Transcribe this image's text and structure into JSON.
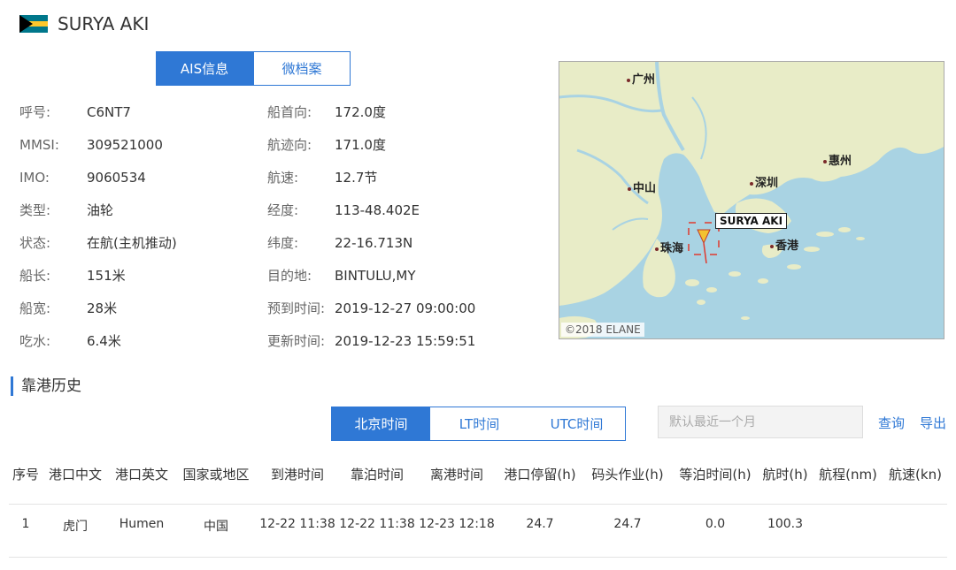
{
  "ship": {
    "name": "SURYA AKI",
    "flag_colors": [
      "#00778b",
      "#ffc72c",
      "#000000"
    ]
  },
  "info_tabs": [
    "AIS信息",
    "微档案"
  ],
  "info_left": [
    {
      "label": "呼号:",
      "value": "C6NT7"
    },
    {
      "label": "MMSI:",
      "value": "309521000"
    },
    {
      "label": "IMO:",
      "value": "9060534"
    },
    {
      "label": "类型:",
      "value": "油轮"
    },
    {
      "label": "状态:",
      "value": "在航(主机推动)"
    },
    {
      "label": "船长:",
      "value": "151米"
    },
    {
      "label": "船宽:",
      "value": "28米"
    },
    {
      "label": "吃水:",
      "value": "6.4米"
    }
  ],
  "info_right": [
    {
      "label": "船首向:",
      "value": "172.0度"
    },
    {
      "label": "航迹向:",
      "value": "171.0度"
    },
    {
      "label": "航速:",
      "value": "12.7节"
    },
    {
      "label": "经度:",
      "value": "113-48.402E"
    },
    {
      "label": "纬度:",
      "value": "22-16.713N"
    },
    {
      "label": "目的地:",
      "value": "BINTULU,MY"
    },
    {
      "label": "预到时间:",
      "value": "2019-12-27 09:00:00"
    },
    {
      "label": "更新时间:",
      "value": "2019-12-23 15:59:51"
    }
  ],
  "map": {
    "cities": [
      "广州",
      "惠州",
      "中山",
      "深圳",
      "珠海",
      "香港"
    ],
    "ship_label": "SURYA AKI",
    "copyright": "©2018 ELANE",
    "colors": {
      "water": "#a9d3e3",
      "land": "#e8ecc7",
      "marker": "#f2c230",
      "box": "#e03a2e"
    }
  },
  "port_history": {
    "title": "靠港历史",
    "time_tabs": [
      "北京时间",
      "LT时间",
      "UTC时间"
    ],
    "range_placeholder": "默认最近一个月",
    "query_label": "查询",
    "export_label": "导出",
    "columns": [
      "序号",
      "港口中文",
      "港口英文",
      "国家或地区",
      "到港时间",
      "靠泊时间",
      "离港时间",
      "港口停留(h)",
      "码头作业(h)",
      "等泊时间(h)",
      "航时(h)",
      "航程(nm)",
      "航速(kn)"
    ],
    "rows": [
      [
        "1",
        "虎门",
        "Humen",
        "中国",
        "12-22 11:38",
        "12-22 11:38",
        "12-23 12:18",
        "24.7",
        "24.7",
        "0.0",
        "100.3",
        "",
        ""
      ]
    ]
  }
}
